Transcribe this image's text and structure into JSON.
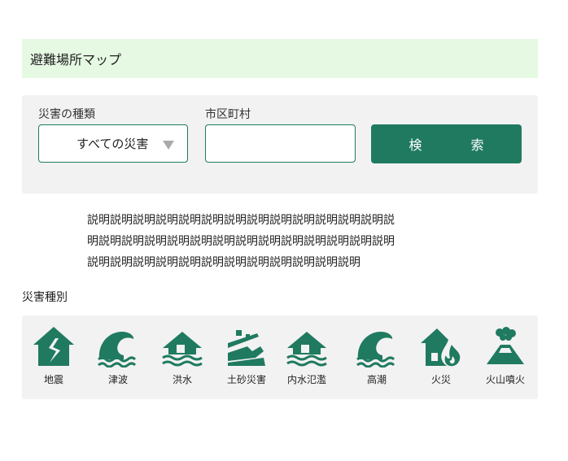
{
  "page_title": "避難場所マップ",
  "search": {
    "disaster_type_label": "災害の種類",
    "disaster_type_value": "すべての災害",
    "city_label": "市区町村",
    "city_value": "",
    "search_button": "検　索"
  },
  "description_lines": [
    "説明説明説明説明説明説明説明説明説明説明説明説明説明説",
    "明説明説明説明説明説明説明説明説明説明説明説明説明説明",
    "説明説明説明説明説明説明説明説明説明説明説明説明"
  ],
  "disaster_section_title": "災害種別",
  "disaster_types": [
    {
      "label": "地震",
      "icon": "earthquake-icon"
    },
    {
      "label": "津波",
      "icon": "tsunami-icon"
    },
    {
      "label": "洪水",
      "icon": "flood-icon"
    },
    {
      "label": "土砂災害",
      "icon": "landslide-icon"
    },
    {
      "label": "内水氾濫",
      "icon": "inland-flood-icon"
    },
    {
      "label": "高潮",
      "icon": "storm-surge-icon"
    },
    {
      "label": "火災",
      "icon": "fire-icon"
    },
    {
      "label": "火山噴火",
      "icon": "volcano-icon"
    }
  ],
  "colors": {
    "accent": "#1f7a60",
    "title_bg": "#e6f9e3",
    "panel_bg": "#f2f2f2"
  }
}
